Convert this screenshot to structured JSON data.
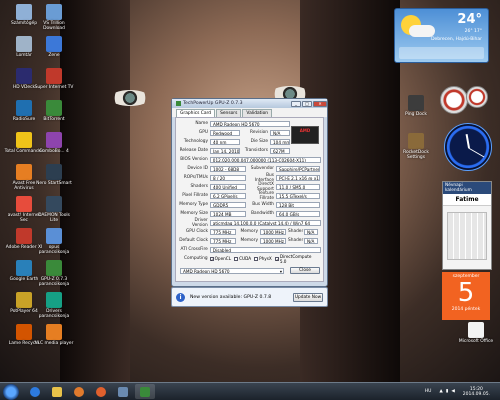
{
  "desktop": {
    "icons_left": [
      {
        "label": "Számítógép"
      },
      {
        "label": "VS Trillion Download"
      },
      {
        "label": "Lomtár"
      },
      {
        "label": "Zene"
      },
      {
        "label": "HD VDeck"
      },
      {
        "label": "Super Internet TV"
      },
      {
        "label": "RadioSure"
      },
      {
        "label": "BitTorrent"
      },
      {
        "label": "Total Commander"
      },
      {
        "label": "ComboBo... 4"
      },
      {
        "label": "Avast Free Antivirus"
      },
      {
        "label": "Nero StartSmart"
      },
      {
        "label": "avast! Internet Sec"
      },
      {
        "label": "DAEMON Tools Lite"
      },
      {
        "label": "Adobe Reader XI"
      },
      {
        "label": "opus parancsikonja"
      },
      {
        "label": "Google Earth"
      },
      {
        "label": "GPU-Z 0.7.3 parancsikonja"
      },
      {
        "label": "PotPlayer 64"
      },
      {
        "label": "Drivers parancsikonja"
      },
      {
        "label": "Lame Recycle"
      },
      {
        "label": "VLC media player"
      }
    ],
    "icons_right": [
      {
        "label": "Ping Dock"
      },
      {
        "label": "RocketDock Settings"
      },
      {
        "label": "Microsoft Office"
      }
    ]
  },
  "window": {
    "title": "TechPowerUp GPU-Z 0.7.3",
    "tabs": [
      "Graphics Card",
      "Sensors",
      "Validation"
    ],
    "logo": "AMD",
    "rows": [
      {
        "label": "Name",
        "value": "AMD Radeon HD 5670"
      },
      {
        "label": "GPU",
        "value": "Redwood",
        "label2": "Revision",
        "value2": "N/A"
      },
      {
        "label": "Technology",
        "value": "40 nm",
        "label2": "Die Size",
        "value2": "104 mm²"
      },
      {
        "label": "Release Date",
        "value": "Jan 14, 2010",
        "label2": "Transistors",
        "value2": "627M"
      },
      {
        "label": "BIOS Version",
        "value": "012.020.000.047.000000 (113-C02604-X11)"
      },
      {
        "label": "Device ID",
        "value": "1002 - 68D8",
        "label2": "Subvendor",
        "value2": "Sapphire/PCPartner (174B)"
      },
      {
        "label": "ROPs/TMUs",
        "value": "8 / 20",
        "label2": "Bus Interface",
        "value2": "PCI-E 2.1 x16 @ x16 1.1"
      },
      {
        "label": "Shaders",
        "value": "400 Unified",
        "label2": "DirectX Support",
        "value2": "11.0 / SM5.0"
      },
      {
        "label": "Pixel Fillrate",
        "value": "6.2 GPixel/s",
        "label2": "Texture Fillrate",
        "value2": "15.5 GTexel/s"
      },
      {
        "label": "Memory Type",
        "value": "GDDR5",
        "label2": "Bus Width",
        "value2": "128 Bit"
      },
      {
        "label": "Memory Size",
        "value": "1024 MB",
        "label2": "Bandwidth",
        "value2": "64.0 GB/s"
      },
      {
        "label": "Driver Version",
        "value": "aticmdag 14.100.0.0 (Catalyst 14.4) / Win7 64"
      },
      {
        "label": "GPU Clock",
        "value": "775 MHz",
        "label2": "Memory",
        "value2": "1000 MHz",
        "label3": "Shader",
        "value3": "N/A"
      },
      {
        "label": "Default Clock",
        "value": "775 MHz",
        "label2": "Memory",
        "value2": "1000 MHz",
        "label3": "Shader",
        "value3": "N/A"
      },
      {
        "label": "ATI CrossFire",
        "value": "Disabled"
      }
    ],
    "computing_label": "Computing",
    "computing": [
      "OpenCL",
      "CUDA",
      "PhysX",
      "DirectCompute 5.0"
    ],
    "device_select": "AMD Radeon HD 5670",
    "close_label": "Close"
  },
  "notification": {
    "icon": "i",
    "message": "New version available: GPU-Z 0.7.8",
    "button": "Update Now"
  },
  "weather": {
    "temp": "24°",
    "range": "26° 17°",
    "location": "Debrecen, Hajdú-Bihar"
  },
  "gadgets": {
    "calendar_title": "Névnapi kalendárium",
    "calendar_name": "Fatime",
    "day_month": "szeptember",
    "day_number": "5",
    "day_sub": "2014 péntek"
  },
  "taskbar": {
    "language": "HU",
    "time": "15:20",
    "date": "2014.09.05."
  },
  "colors": {
    "accent": "#2d62c8",
    "amd_red": "#e33333",
    "cal_orange": "#f26321"
  }
}
